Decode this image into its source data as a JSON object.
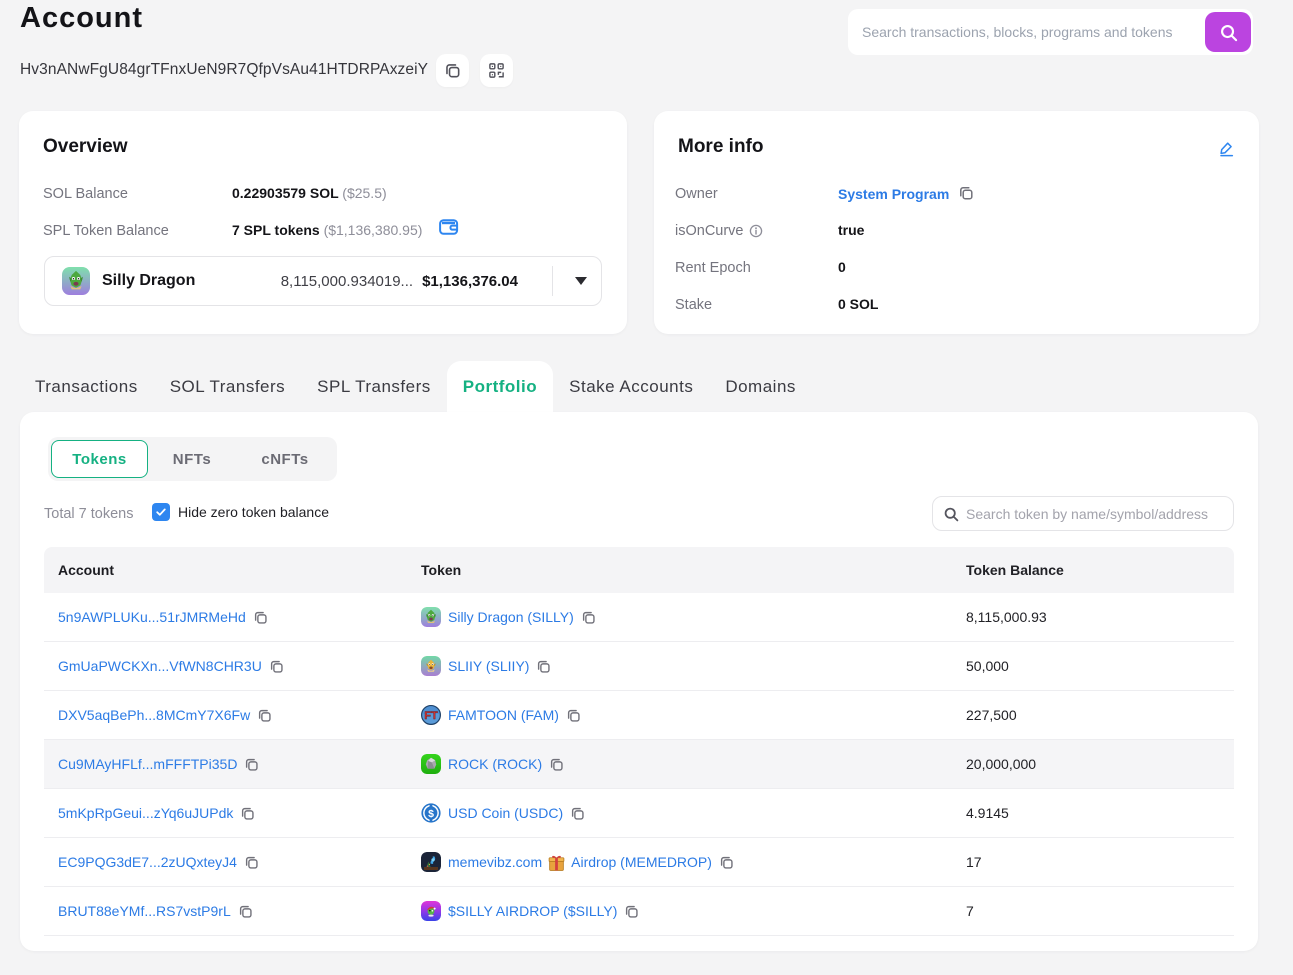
{
  "page": {
    "title": "Account"
  },
  "header": {
    "search_placeholder": "Search transactions, blocks, programs and tokens",
    "address": "Hv3nANwFgU84grTFnxUeN9R7QfpVsAu41HTDRPAxzeiY"
  },
  "overview": {
    "title": "Overview",
    "sol_balance": {
      "label": "SOL Balance",
      "value": "0.22903579 SOL",
      "usd": "($25.5)"
    },
    "spl_balance": {
      "label": "SPL Token Balance",
      "value": "7 SPL tokens",
      "usd": "($1,136,380.95)"
    },
    "token_selector": {
      "name": "Silly Dragon",
      "amount": "8,115,000.934019...",
      "usd_value": "$1,136,376.04"
    }
  },
  "more_info": {
    "title": "More info",
    "owner": {
      "label": "Owner",
      "value": "System Program"
    },
    "is_on_curve": {
      "label": "isOnCurve",
      "value": "true"
    },
    "rent_epoch": {
      "label": "Rent Epoch",
      "value": "0"
    },
    "stake": {
      "label": "Stake",
      "value": "0 SOL"
    }
  },
  "tabs": {
    "transactions": "Transactions",
    "sol_transfers": "SOL Transfers",
    "spl_transfers": "SPL Transfers",
    "portfolio": "Portfolio",
    "stake_accounts": "Stake Accounts",
    "domains": "Domains",
    "active": "Portfolio"
  },
  "portfolio": {
    "segments": {
      "tokens": "Tokens",
      "nfts": "NFTs",
      "cnfts": "cNFTs",
      "active": "Tokens"
    },
    "total_text": "Total 7 tokens",
    "hide_zero_label": "Hide zero token balance",
    "hide_zero_checked": true,
    "search_placeholder": "Search token by name/symbol/address",
    "table": {
      "headers": {
        "account": "Account",
        "token": "Token",
        "balance": "Token Balance"
      },
      "rows": [
        {
          "account": "5n9AWPLUKu...51rJMRMeHd",
          "token": "Silly Dragon (SILLY)",
          "balance": "8,115,000.93",
          "icon": "silly-dragon"
        },
        {
          "account": "GmUaPWCKXn...VfWN8CHR3U",
          "token": "SLIIY (SLIIY)",
          "balance": "50,000",
          "icon": "sliiy"
        },
        {
          "account": "DXV5aqBePh...8MCmY7X6Fw",
          "token": "FAMTOON (FAM)",
          "balance": "227,500",
          "icon": "famtoon"
        },
        {
          "account": "Cu9MAyHFLf...mFFFTPi35D",
          "token": "ROCK (ROCK)",
          "balance": "20,000,000",
          "icon": "rock",
          "highlighted": true
        },
        {
          "account": "5mKpRpGeui...zYq6uJUPdk",
          "token": "USD Coin (USDC)",
          "balance": "4.9145",
          "icon": "usdc"
        },
        {
          "account": "EC9PQG3dE7...2zUQxteyJ4",
          "token_before_gift": "memevibz.com",
          "token_after_gift": "Airdrop (MEMEDROP)",
          "balance": "17",
          "icon": "memedrop"
        },
        {
          "account": "BRUT88eYMf...RS7vstP9rL",
          "token": "$SILLY AIRDROP ($SILLY)",
          "balance": "7",
          "icon": "silly-airdrop"
        }
      ]
    }
  },
  "colors": {
    "accent_purple": "#bb44e0",
    "accent_teal": "#15b182",
    "link_blue": "#2c7be5",
    "checkbox_blue": "#2e86f0",
    "page_background": "#f4f4f5"
  }
}
